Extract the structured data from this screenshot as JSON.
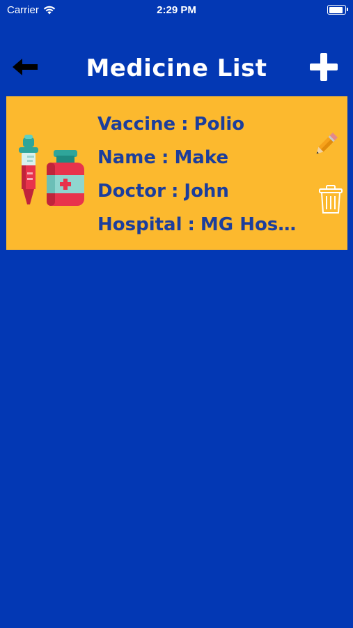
{
  "status_bar": {
    "carrier": "Carrier",
    "time": "2:29 PM",
    "battery_level": 1.0,
    "wifi_icon": "wifi-icon",
    "battery_icon": "battery-icon"
  },
  "header": {
    "title": "Medicine List",
    "back_icon": "arrow-left-icon",
    "add_icon": "plus-icon"
  },
  "colors": {
    "background": "#0338b4",
    "card": "#fcb92e",
    "card_text": "#1c3e9c",
    "header_text": "#ffffff"
  },
  "medicines": [
    {
      "illustration": "medicine-bottle-and-syringe-icon",
      "vaccine_label": "Vaccine",
      "vaccine": "Polio",
      "name_label": "Name",
      "name": "Make",
      "doctor_label": "Doctor",
      "doctor": "John",
      "hospital_label": "Hospital",
      "hospital": "MG Hospi...",
      "separator": ":",
      "edit_icon": "pencil-icon",
      "delete_icon": "trash-icon"
    }
  ]
}
